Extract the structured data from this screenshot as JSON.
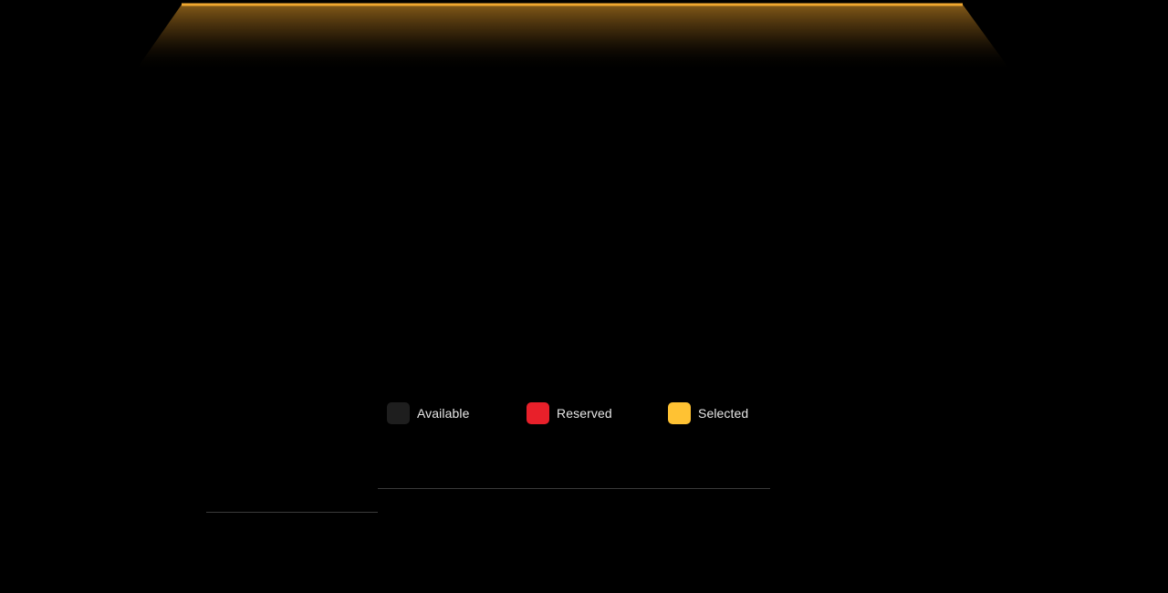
{
  "screen": {
    "accent": "#f0a830"
  },
  "legend": {
    "items": [
      {
        "key": "available",
        "label": "Available",
        "color": "#1e1e1e"
      },
      {
        "key": "reserved",
        "label": "Reserved",
        "color": "#e8202a"
      },
      {
        "key": "selected",
        "label": "Selected",
        "color": "#ffc233"
      }
    ]
  }
}
